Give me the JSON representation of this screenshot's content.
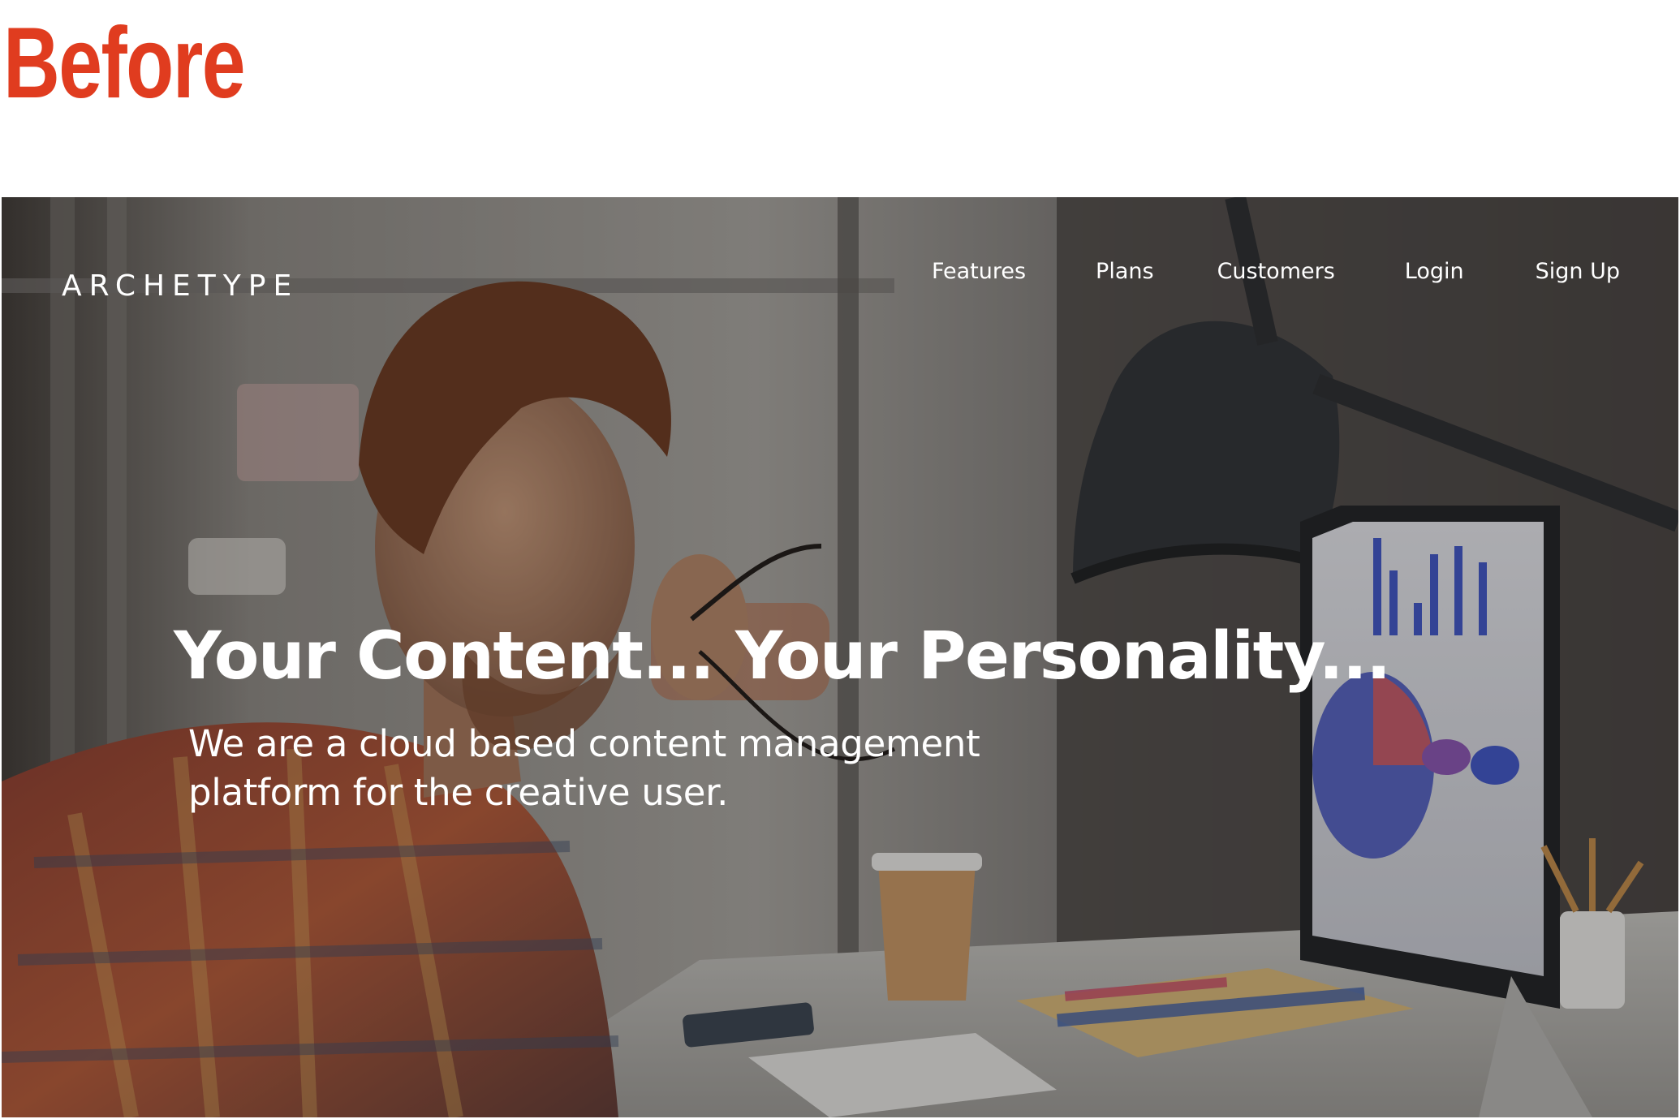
{
  "page_label": "Before",
  "header": {
    "logo": "ARCHETYPE",
    "nav": [
      "Features",
      "Plans",
      "Customers",
      "Login",
      "Sign Up"
    ]
  },
  "hero": {
    "headline": "Your Content... Your Personality...",
    "subheadline_line1": "We are a cloud based content management",
    "subheadline_line2": "platform for the creative user."
  },
  "colors": {
    "label": "#e03c1f",
    "hero_text": "#ffffff"
  }
}
